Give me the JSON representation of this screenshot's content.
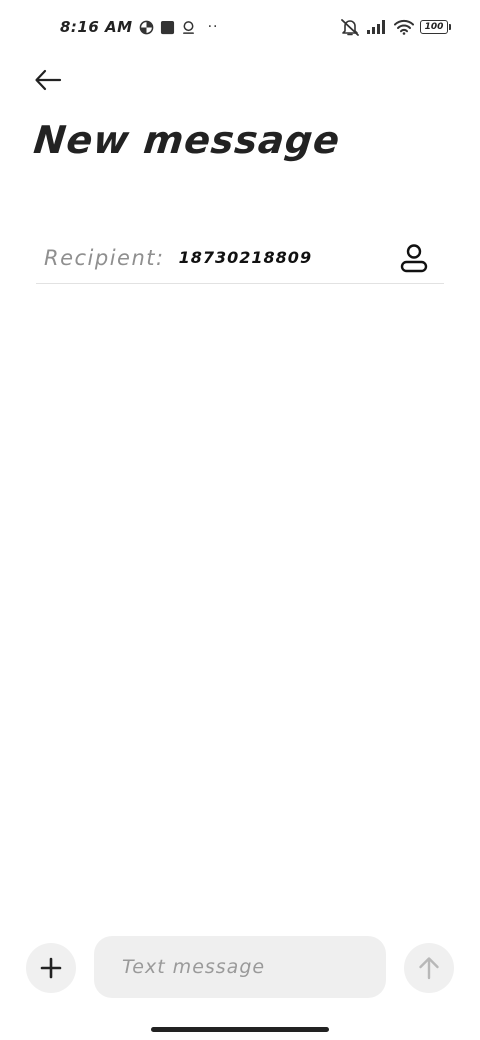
{
  "status_bar": {
    "time": "8:16 AM",
    "more_dots": "··",
    "battery_level": "100",
    "icons": [
      "data-saver-icon",
      "square-notification-icon",
      "location-icon",
      "mute-icon",
      "signal-icon",
      "wifi-icon",
      "battery-icon"
    ]
  },
  "header": {
    "back_icon": "arrow-left-icon",
    "title": "New message"
  },
  "recipient": {
    "label": "Recipient:",
    "value": "18730218809",
    "contact_icon": "person-icon"
  },
  "composer": {
    "add_icon": "plus-icon",
    "placeholder": "Text message",
    "value": "",
    "send_icon": "arrow-up-icon"
  },
  "colors": {
    "background": "#ffffff",
    "text_primary": "#222222",
    "text_muted": "#8f8f8f",
    "button_bg": "#f0f0f0",
    "send_disabled": "#b8b8b8"
  }
}
